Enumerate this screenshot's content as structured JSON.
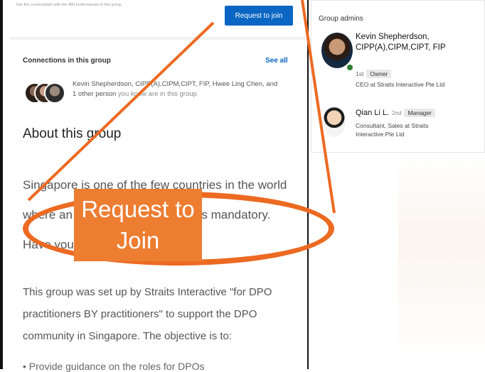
{
  "join_prompt": "Join the conversation with the 489 professionals in this group",
  "join_button": "Request to join",
  "connections": {
    "title": "Connections in this group",
    "see_all": "See all",
    "names": "Kevin Shepherdson, CIPP(A),CIPM,CIPT, FIP, Hwee Ling Chen, and 1 other person",
    "suffix": " you know are in this group"
  },
  "about_title": "About this group",
  "about_para1": "Singapore is one of the few countries in the world where an appointment of a DPO is mandatory. Have you been appointed?",
  "about_para2": "This group was set up by Straits Interactive \"for DPO practitioners BY practitioners\" to support the DPO community in Singapore. The objective is to:",
  "about_bullet": "• Provide guidance on the roles for DPOs",
  "admins": {
    "title": "Group admins",
    "admin1": {
      "name": "Kevin Shepherdson, CIPP(A),CIPM,CIPT, FIP",
      "degree": "1st",
      "role": "Owner",
      "headline": "CEO at Straits Interactive Pte Ltd"
    },
    "admin2": {
      "name": "Qian Li L.",
      "degree": "2nd",
      "role": "Manager",
      "headline": "Consultant, Sales at Straits Interactive Pte Ltd"
    }
  },
  "callout": "Request to Join",
  "colors": {
    "accent": "#ec6a22",
    "callout_fill": "#ed7d31",
    "link": "#0a66c2"
  }
}
